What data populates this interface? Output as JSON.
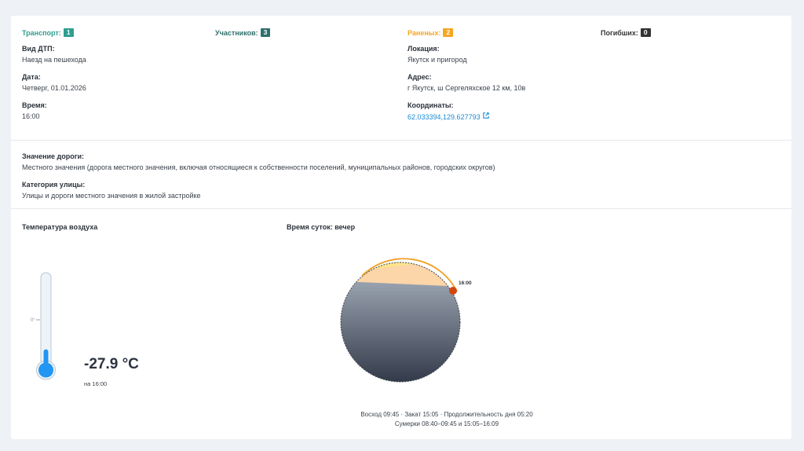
{
  "stats": {
    "transport": {
      "label": "Транспорт:",
      "count": "1",
      "color": "#2e9e8f"
    },
    "participants": {
      "label": "Участников:",
      "count": "3",
      "color": "#2f6f6d"
    },
    "injured": {
      "label": "Раненых:",
      "count": "2",
      "color": "#f5a623"
    },
    "dead": {
      "label": "Погибших:",
      "count": "0",
      "color": "#333333"
    }
  },
  "details": {
    "accident_type": {
      "label": "Вид ДТП:",
      "value": "Наезд на пешехода"
    },
    "date": {
      "label": "Дата:",
      "value": "Четверг, 01.01.2026"
    },
    "time": {
      "label": "Время:",
      "value": "16:00"
    },
    "location": {
      "label": "Локация:",
      "value": "Якутск и пригород"
    },
    "address": {
      "label": "Адрес:",
      "value": "г Якутск, ш Сергеляхское 12 км, 10в"
    },
    "coordinates": {
      "label": "Координаты:",
      "value": "62.033394,129.627793",
      "link_icon": "external-link-icon"
    }
  },
  "road": {
    "significance": {
      "label": "Значение дороги:",
      "value": "Местного значения (дорога местного значения, включая относящиеся к собственности поселений, муниципальных районов, городских округов)"
    },
    "street_category": {
      "label": "Категория улицы:",
      "value": "Улицы и дороги местного значения в жилой застройке"
    }
  },
  "weather": {
    "title": "Температура воздуха",
    "zero_label": "0°",
    "temperature": "-27.9 °C",
    "measured_at": "на 16:00",
    "level_fraction": 0.22,
    "colors": {
      "mercury": "#2196f3",
      "tube": "#eef3f8"
    }
  },
  "daytime": {
    "title": "Время суток: вечер",
    "marker_time": "16:00",
    "sunrise_line": "Восход 09:45 · Закат 15:05 · Продолжительность дня 05:20",
    "twilight_line": "Сумерки 08:40–09:45 и 15:05–16:09",
    "colors": {
      "day": "#fde58a",
      "twilight": "#fcd5a8",
      "night_top": "#9aa3b0",
      "night_bottom": "#141b2b",
      "marker": "#d3470e",
      "sun_arc": "#f0a020"
    }
  }
}
